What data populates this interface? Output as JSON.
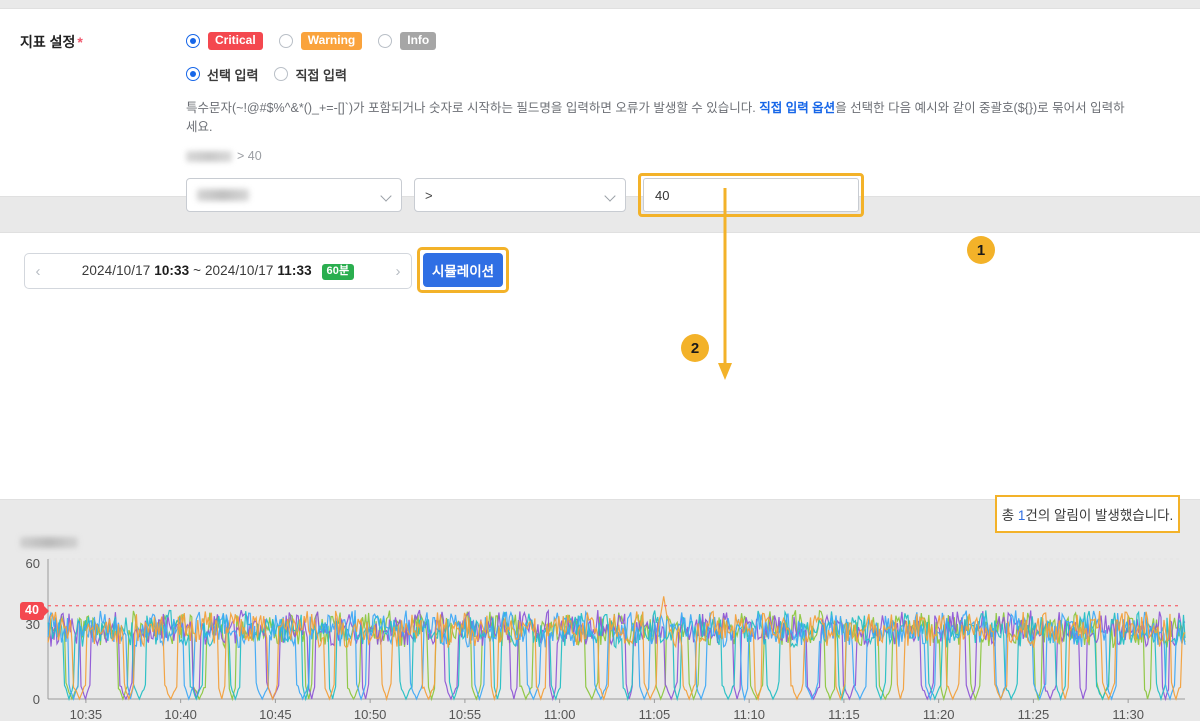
{
  "form": {
    "label": "지표 설정",
    "required_mark": "*",
    "severity_options": [
      {
        "label": "Critical",
        "selected": true,
        "color": "#f4484f"
      },
      {
        "label": "Warning",
        "selected": false,
        "color": "#faa33c"
      },
      {
        "label": "Info",
        "selected": false,
        "color": "#a6a6a6"
      }
    ],
    "input_mode_options": [
      {
        "label": "선택 입력",
        "selected": true
      },
      {
        "label": "직접 입력",
        "selected": false
      }
    ],
    "description_part1": "특수문자(~!@#$%^&*()_+=-[]`)가 포함되거나 숫자로 시작하는 필드명을 입력하면 오류가 발생할 수 있습니다. ",
    "description_link": "직접 입력 옵션",
    "description_part2": "을 선택한 다음 예시와 같이 중괄호(${})로 묶어서 입력하세요.",
    "example_suffix": "> 40",
    "metric_select_value": "",
    "operator_select_value": ">",
    "threshold_value": "40",
    "threshold_placeholder": ""
  },
  "chart_panel": {
    "range_prefix": "2024/10/17",
    "range_start_time": "10:33",
    "range_separator": "~",
    "range_end_date": "2024/10/17",
    "range_end_time": "11:33",
    "duration_badge": "60분",
    "prev_arrow": "‹",
    "next_arrow": "›",
    "simulation_button": "시뮬레이션",
    "alert_summary_prefix": "총 ",
    "alert_summary_count": "1",
    "alert_summary_suffix": "건의 알림이 발생했습니다.",
    "chart_title": ""
  },
  "callouts": [
    {
      "number": "1",
      "target": "alert-summary"
    },
    {
      "number": "2",
      "target": "threshold-line"
    }
  ],
  "chart_data": {
    "type": "line",
    "title": "",
    "xlabel": "",
    "ylabel": "",
    "ylim": [
      0,
      60
    ],
    "yticks": [
      0,
      30,
      60
    ],
    "grid": true,
    "legend": "none",
    "x_start": "10:33",
    "x_end": "11:33",
    "xticks": [
      "10:35",
      "10:40",
      "10:45",
      "10:50",
      "10:55",
      "11:00",
      "11:05",
      "11:10",
      "11:15",
      "11:20",
      "11:25",
      "11:30"
    ],
    "threshold": {
      "value": 40,
      "label": "40",
      "color": "#f4484f",
      "style": "dotted"
    },
    "baseline_mean": 30,
    "noise_amplitude": 6,
    "alert_count": 1,
    "alert_point": {
      "x_label": "11:05",
      "y": 44,
      "series": "series-1"
    },
    "series": [
      {
        "name": "series-1",
        "color": "#f2a03c",
        "mean": 30,
        "drop_count": 22
      },
      {
        "name": "series-2",
        "color": "#3fa9f5",
        "mean": 30,
        "drop_count": 20
      },
      {
        "name": "series-3",
        "color": "#25bfc4",
        "mean": 30,
        "drop_count": 21
      },
      {
        "name": "series-4",
        "color": "#8f57d6",
        "mean": 30,
        "drop_count": 19
      },
      {
        "name": "series-5",
        "color": "#8cc63f",
        "mean": 30,
        "drop_count": 20
      }
    ]
  }
}
